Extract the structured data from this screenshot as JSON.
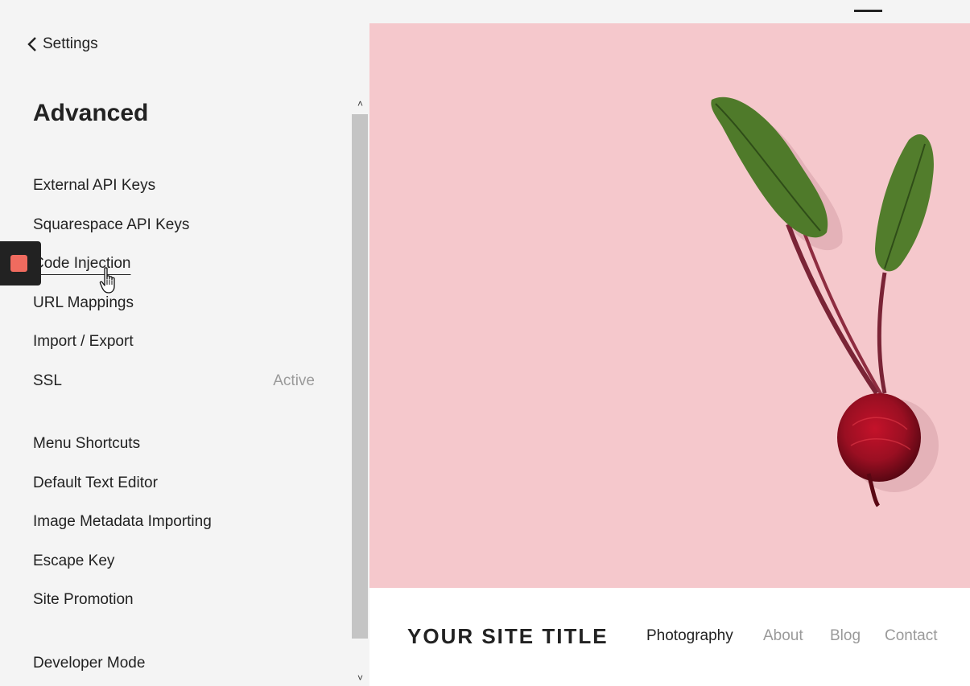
{
  "sidebar": {
    "back_label": "Settings",
    "heading": "Advanced",
    "group1": [
      {
        "label": "External API Keys",
        "status": ""
      },
      {
        "label": "Squarespace API Keys",
        "status": ""
      },
      {
        "label": "Code Injection",
        "status": ""
      },
      {
        "label": "URL Mappings",
        "status": ""
      },
      {
        "label": "Import / Export",
        "status": ""
      },
      {
        "label": "SSL",
        "status": "Active"
      }
    ],
    "group2": [
      {
        "label": "Menu Shortcuts"
      },
      {
        "label": "Default Text Editor"
      },
      {
        "label": "Image Metadata Importing"
      },
      {
        "label": "Escape Key"
      },
      {
        "label": "Site Promotion"
      }
    ],
    "group3": [
      {
        "label": "Developer Mode"
      }
    ]
  },
  "preview": {
    "site_title": "YOUR SITE TITLE",
    "nav": [
      "Photography",
      "About",
      "Blog",
      "Contact"
    ]
  },
  "colors": {
    "hero_background": "#f5c8cc",
    "badge_accent": "#f06b5f"
  },
  "icons": [
    "chevron-left-icon",
    "hand-cursor-icon",
    "scroll-up-icon",
    "scroll-down-icon"
  ]
}
